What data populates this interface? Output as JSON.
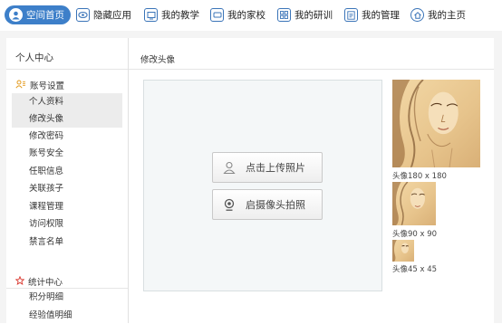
{
  "nav": {
    "items": [
      {
        "label": "空间首页",
        "icon": "user-circle-icon"
      },
      {
        "label": "隐藏应用",
        "icon": "eye-icon"
      },
      {
        "label": "我的教学",
        "icon": "teach-icon"
      },
      {
        "label": "我的家校",
        "icon": "screen-icon"
      },
      {
        "label": "我的研训",
        "icon": "grid-icon"
      },
      {
        "label": "我的管理",
        "icon": "list-icon"
      },
      {
        "label": "我的主页",
        "icon": "home-icon"
      }
    ]
  },
  "sidebar": {
    "title": "个人中心",
    "account_group": {
      "label": "账号设置",
      "items": [
        "个人资料",
        "修改头像",
        "修改密码",
        "账号安全",
        "任职信息",
        "关联孩子",
        "课程管理",
        "访问权限",
        "禁言名单"
      ]
    },
    "stats_group": {
      "label": "统计中心",
      "items": [
        "积分明细",
        "经验值明细"
      ]
    }
  },
  "main": {
    "title": "修改头像",
    "upload_button": "点击上传照片",
    "camera_button": "启摄像头拍照",
    "avatar_labels": {
      "large": "头像180 x 180",
      "medium": "头像90 x 90",
      "small": "头像45 x 45"
    }
  },
  "colors": {
    "accent": "#3d7fc9",
    "sidebar_selected": "#ececec",
    "avatar_tone": "#e7c48c"
  }
}
